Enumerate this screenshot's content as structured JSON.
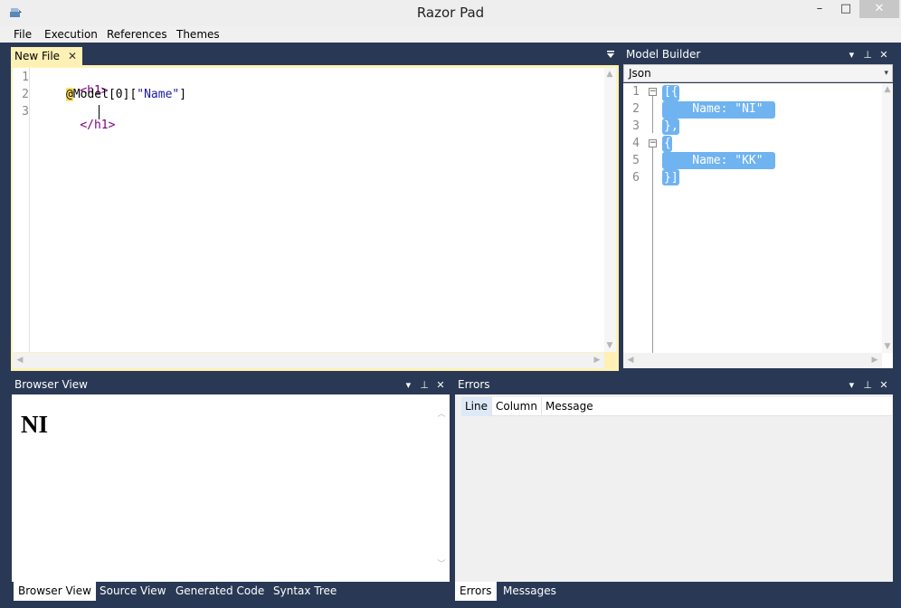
{
  "window": {
    "title": "Razor Pad",
    "minimize": "–",
    "maximize": "□",
    "close": "✕"
  },
  "menu": [
    "File",
    "Execution",
    "References",
    "Themes"
  ],
  "editor": {
    "tab_label": "New File",
    "tab_close": "✕",
    "line_numbers": [
      "1",
      "2",
      "3"
    ],
    "lines": {
      "l1_tag": "<h1>",
      "l2_at": "@",
      "l2_model": "Model[0][",
      "l2_str": "\"Name\"",
      "l2_end": "]",
      "l3_tag": "</h1>"
    }
  },
  "model_builder": {
    "title": "Model Builder",
    "format": "Json",
    "line_numbers": [
      "1",
      "2",
      "3",
      "4",
      "5",
      "6"
    ],
    "json_lines": [
      "[{",
      "    Name: \"NI\"",
      "},",
      "{",
      "    Name: \"KK\"",
      "}]"
    ]
  },
  "browser_view": {
    "title": "Browser View",
    "heading": "NI",
    "tabs": [
      "Browser View",
      "Source View",
      "Generated Code",
      "Syntax Tree"
    ]
  },
  "errors": {
    "title": "Errors",
    "columns": [
      "Line",
      "Column",
      "Message"
    ],
    "tabs": [
      "Errors",
      "Messages"
    ]
  },
  "panel_buttons": {
    "menu": "▾",
    "pin": "⊥",
    "close": "✕"
  },
  "colors": {
    "background": "#293955",
    "editor_tab": "#fff1b5",
    "selection": "#6fb3f0"
  }
}
